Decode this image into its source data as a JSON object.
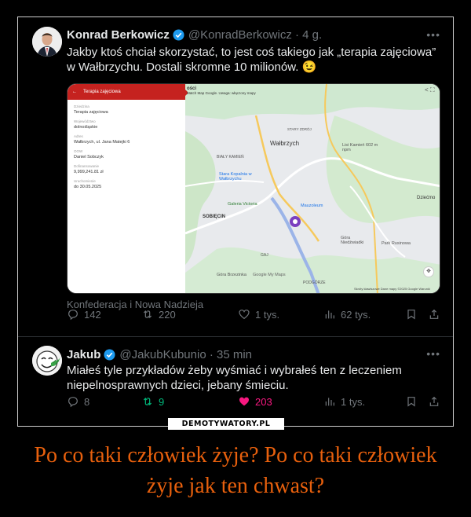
{
  "tweet1": {
    "name": "Konrad Berkowicz",
    "handle": "@KonradBerkowicz · 4 g.",
    "text": "Jakby ktoś chciał skorzystać, to jest coś takiego jak „terapia zajęciowa” w Wałbrzychu. Dostali skromne 10 milionów. 😉",
    "affiliation": "Konfederacja i Nowa Nadzieja",
    "stats": {
      "replies": "142",
      "reposts": "220",
      "likes": "1 tys.",
      "views": "62 tys."
    }
  },
  "media": {
    "panel_title": "Terapia zajęciowa",
    "fields": [
      {
        "label": "Dziedzina",
        "value": "Terapia zajęciowa"
      },
      {
        "label": "Województwo",
        "value": "dolnośląskie"
      },
      {
        "label": "Adres",
        "value": "Wałbrzych, ul. Jana Matejki 6"
      },
      {
        "label": "OOW",
        "value": "Daniel Sobczyk"
      },
      {
        "label": "Dofinansowanie",
        "value": "9,999,241.81 zł"
      },
      {
        "label": "Uruchomienie",
        "value": "do 30.05.2025"
      }
    ],
    "map_header": "ości",
    "map_info": "Match Map Google. Uwaga: włączony mapy",
    "map_labels": {
      "walbrzych": "Wałbrzych",
      "bialy_kamien": "BIAŁY KAMIEŃ",
      "stara_kopalnia": "Stara Kopalnia w Wałbrzychu",
      "galeria": "Galeria Victoria",
      "sobiecin": "SOBIĘCIN",
      "mauzoleum": "Mauzoleum",
      "lisi_kamien": "Lisi Kamień 602 m npm",
      "gora_niedzwiadki": "Góra Niedźwiadki",
      "gora_brzezinka": "Góra Brzezinka",
      "park_rusinowa": "Park Rusinowa",
      "dziecmo": "Dziećmo",
      "podgorze": "PODGÓRZE",
      "gaj": "GAJ",
      "stary_zdroj": "STARY ZDRÓJ",
      "google_my_maps": "Google My Maps",
      "footer": "Skróty klawiszowe   Dane mapy ©2025 Google   Warunki"
    }
  },
  "tweet2": {
    "name": "Jakub",
    "handle": "@JakubKubunio · 35 min",
    "text": "Miałeś tyle przykładów żeby wyśmiać i wybrałeś ten z leczeniem niepelnosprawnych dzieci, jebany śmieciu.",
    "stats": {
      "replies": "8",
      "reposts": "9",
      "likes": "203",
      "views": "1 tys."
    }
  },
  "watermark": "DEMOTYWATORY.PL",
  "caption": "Po co taki człowiek żyje? Po co taki człowiek żyje jak ten chwast?",
  "colors": {
    "accent": "#e8600d",
    "verified": "#1d9bf0",
    "repost_green": "#00ba7c",
    "like_pink": "#f91880"
  }
}
